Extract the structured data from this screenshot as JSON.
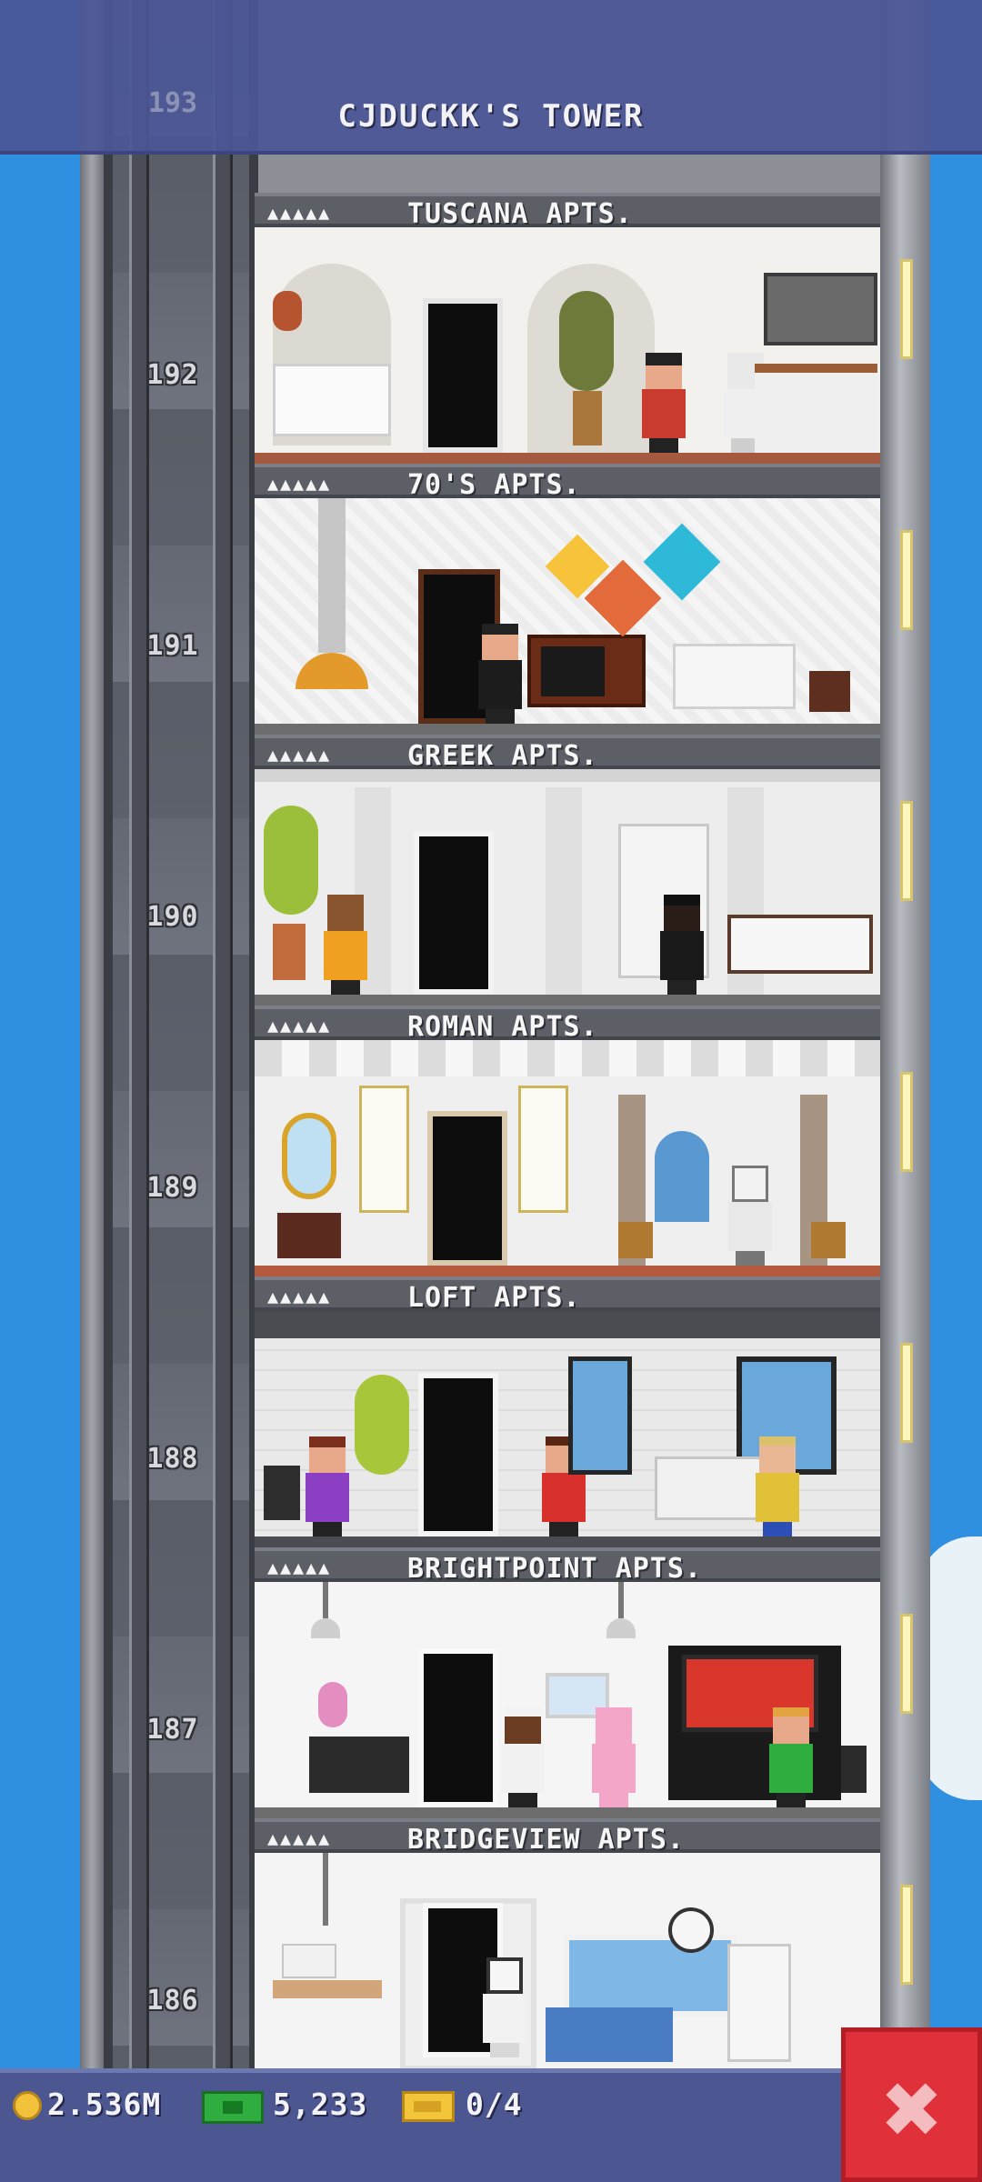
{
  "tower": {
    "title": "CJDUCKK'S TOWER",
    "top_floor_number": "193"
  },
  "floors": [
    {
      "number": "192",
      "label": "TUSCANA APTS.",
      "stars": "▲▲▲▲▲"
    },
    {
      "number": "191",
      "label": "70'S APTS.",
      "stars": "▲▲▲▲▲"
    },
    {
      "number": "190",
      "label": "GREEK APTS.",
      "stars": "▲▲▲▲▲"
    },
    {
      "number": "189",
      "label": "ROMAN APTS.",
      "stars": "▲▲▲▲▲"
    },
    {
      "number": "188",
      "label": "LOFT APTS.",
      "stars": "▲▲▲▲▲"
    },
    {
      "number": "187",
      "label": "BRIGHTPOINT APTS.",
      "stars": "▲▲▲▲▲"
    },
    {
      "number": "186",
      "label": "BRIDGEVIEW APTS.",
      "stars": "▲▲▲▲▲"
    }
  ],
  "stats": {
    "coins": "2.536M",
    "bux": "5,233",
    "vip": "0/4"
  },
  "icons": {
    "coin": "coin-icon",
    "bux": "bux-icon",
    "vip": "vip-ticket-icon",
    "close": "close-icon"
  },
  "colors": {
    "sky": "#2f8fe0",
    "banner": "#4a5696",
    "close_button": "#e0303a",
    "floor_trim": "#a35a3e"
  }
}
